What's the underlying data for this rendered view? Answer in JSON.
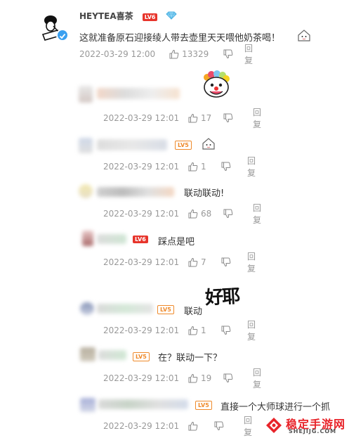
{
  "main_post": {
    "username": "HEYTEA喜茶",
    "level": "LV6",
    "text": "这就准备原石迎接绫人带去壶里天天喂他奶茶喝！",
    "timestamp": "2022-03-29 12:00",
    "likes": "13329",
    "reply_label": "回复"
  },
  "replies": [
    {
      "level": "",
      "text": "",
      "timestamp": "2022-03-29 12:01",
      "likes": "17",
      "reply_label": "回复",
      "sticker": "clown-face"
    },
    {
      "level": "LV5",
      "text": "",
      "timestamp": "2022-03-29 12:01",
      "likes": "1",
      "reply_label": "回复",
      "sticker": "small-face"
    },
    {
      "level": "",
      "text": "联动联动!",
      "timestamp": "2022-03-29 12:01",
      "likes": "68",
      "reply_label": "回复"
    },
    {
      "level": "LV6",
      "text": "踩点是吧",
      "timestamp": "2022-03-29 12:01",
      "likes": "7",
      "reply_label": "回复"
    },
    {
      "level": "LV5",
      "text": "联动",
      "timestamp": "2022-03-29 12:01",
      "likes": "1",
      "reply_label": "回复",
      "sticker_text": "好耶"
    },
    {
      "level": "LV5",
      "text": "在？联动一下？",
      "timestamp": "2022-03-29 12:01",
      "likes": "19",
      "reply_label": "回复"
    },
    {
      "level": "LV5",
      "text": "直接一个大师球进行一个抓",
      "timestamp": "2022-03-29 12:01",
      "likes": "",
      "reply_label": "回复"
    }
  ],
  "watermark": {
    "brand": "稳定手游网",
    "url": "SHEJIJG.COM"
  },
  "colors": {
    "level_red": "#e7342b",
    "level_orange": "#ef8a2b",
    "meta_gray": "#999999",
    "verified_blue": "#3aa0f0"
  }
}
